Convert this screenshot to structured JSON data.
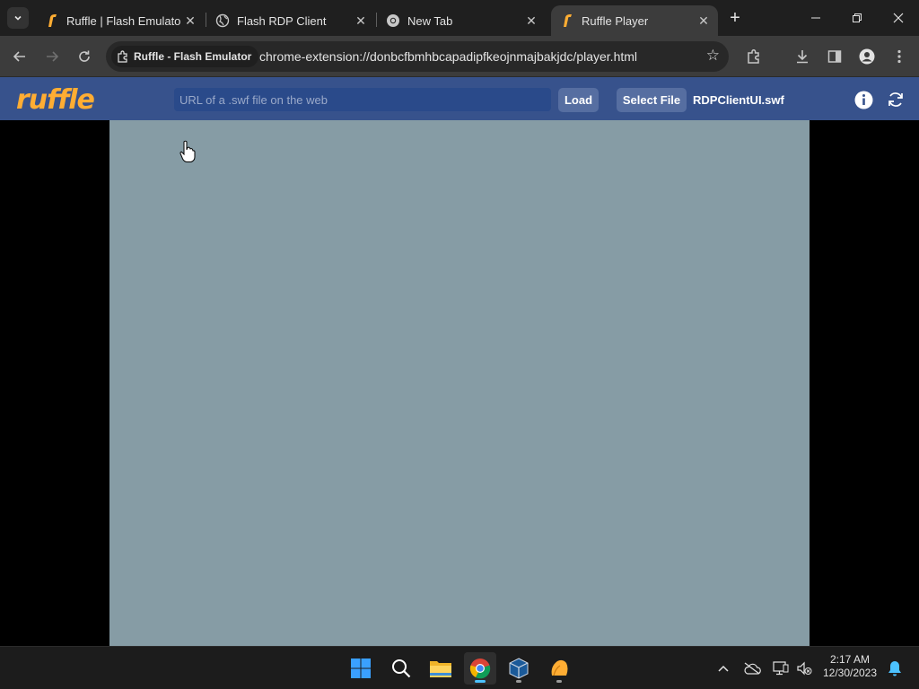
{
  "tabs": [
    {
      "title": "Ruffle | Flash Emulator",
      "icon": "ruffle-icon"
    },
    {
      "title": "Flash RDP Client",
      "icon": "globe-icon"
    },
    {
      "title": "New Tab",
      "icon": "chrome-icon"
    },
    {
      "title": "Ruffle Player",
      "icon": "ruffle-icon",
      "active": true
    }
  ],
  "toolbar": {
    "site_chip": "Ruffle - Flash Emulator",
    "url": "chrome-extension://donbcfbmhbcapadipfkeojnmajbakjdc/player.html"
  },
  "ruffle": {
    "logo": "ruffle",
    "url_placeholder": "URL of a .swf file on the web",
    "load_label": "Load",
    "select_file_label": "Select File",
    "file_name": "RDPClientUI.swf"
  },
  "colors": {
    "header_bg": "#37528c",
    "logo": "#ffad33",
    "stage_bg": "#869ca5",
    "taskbar_bg": "#1c1c1c"
  },
  "taskbar": {
    "apps": [
      "start-icon",
      "search-icon",
      "file-explorer-icon",
      "chrome-icon",
      "virtualbox-icon",
      "ruffle-app-icon"
    ],
    "time": "2:17 AM",
    "date": "12/30/2023"
  }
}
